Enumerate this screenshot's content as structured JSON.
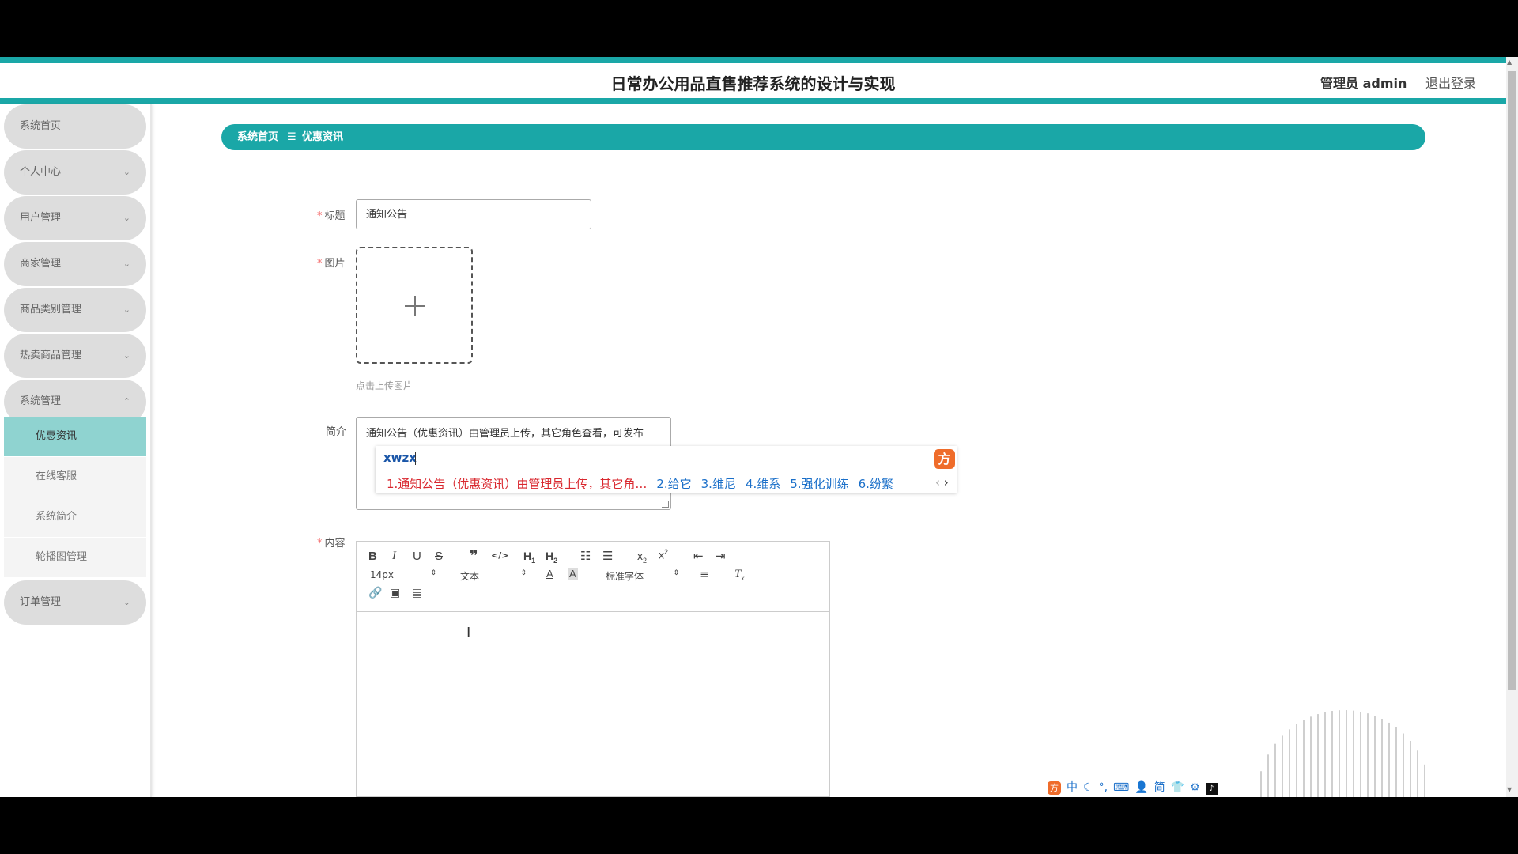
{
  "header": {
    "title": "日常办公用品直售推荐系统的设计与实现",
    "user": "管理员 admin",
    "logout": "退出登录"
  },
  "sidebar": {
    "items": [
      {
        "label": "系统首页"
      },
      {
        "label": "个人中心",
        "chevron": "⌄"
      },
      {
        "label": "用户管理",
        "chevron": "⌄"
      },
      {
        "label": "商家管理",
        "chevron": "⌄"
      },
      {
        "label": "商品类别管理",
        "chevron": "⌄"
      },
      {
        "label": "热卖商品管理",
        "chevron": "⌄"
      },
      {
        "label": "系统管理",
        "chevron": "⌃"
      },
      {
        "label": "订单管理",
        "chevron": "⌄"
      }
    ],
    "subitems": [
      {
        "label": "优惠资讯"
      },
      {
        "label": "在线客服"
      },
      {
        "label": "系统简介"
      },
      {
        "label": "轮播图管理"
      }
    ]
  },
  "breadcrumb": {
    "home": "系统首页",
    "separator": "☰",
    "current": "优惠资讯"
  },
  "form": {
    "required_mark": "*",
    "title_label": "标题",
    "title_value": "通知公告",
    "image_label": "图片",
    "upload_hint": "点击上传图片",
    "intro_label": "简介",
    "intro_value": "通知公告（优惠资讯）由管理员上传，其它角色查看，可发布",
    "content_label": "内容"
  },
  "editor": {
    "font_size": "14px",
    "block_type": "文本",
    "font_family": "标准字体"
  },
  "ime": {
    "typed": "xwzx",
    "candidates": [
      "1.通知公告（优惠资讯）由管理员上传，其它角…",
      "2.给它",
      "3.维尼",
      "4.维系",
      "5.强化训练",
      "6.纷繁"
    ],
    "tray": [
      "中",
      "简"
    ]
  },
  "colors": {
    "accent": "#1aa7a7",
    "active_subitem": "#8fd3d0",
    "menu_bg": "#dddddd"
  }
}
